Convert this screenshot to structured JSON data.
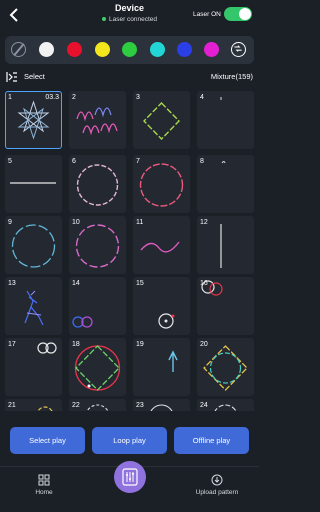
{
  "header": {
    "title": "Device",
    "status": "Laser connected",
    "laser_toggle_label": "Laser ON",
    "laser_on": true,
    "back_icon": "chevron-left-icon"
  },
  "colors": {
    "swatches": [
      "none",
      "#f2f2f2",
      "#e8112d",
      "#f3e61c",
      "#2ecc40",
      "#23d6d6",
      "#2b3fe6",
      "#e31fd1",
      "mix"
    ],
    "accent": "#3f6ad8",
    "selection_outline": "#4da3ff"
  },
  "toolbar": {
    "select_label": "Select",
    "mixture_label": "Mixture(159)"
  },
  "patterns": [
    {
      "num": "1",
      "badge": "03.3",
      "selected": true
    },
    {
      "num": "2"
    },
    {
      "num": "3"
    },
    {
      "num": "4"
    },
    {
      "num": "5"
    },
    {
      "num": "6"
    },
    {
      "num": "7"
    },
    {
      "num": "8"
    },
    {
      "num": "9"
    },
    {
      "num": "10"
    },
    {
      "num": "11"
    },
    {
      "num": "12"
    },
    {
      "num": "13"
    },
    {
      "num": "14"
    },
    {
      "num": "15"
    },
    {
      "num": "16"
    },
    {
      "num": "17"
    },
    {
      "num": "18"
    },
    {
      "num": "19"
    },
    {
      "num": "20"
    },
    {
      "num": "21"
    },
    {
      "num": "22"
    },
    {
      "num": "23"
    },
    {
      "num": "24"
    }
  ],
  "actions": {
    "select_play": "Select play",
    "loop_play": "Loop play",
    "offline_play": "Offline play"
  },
  "nav": {
    "home": "Home",
    "upload": "Upload pattern"
  }
}
